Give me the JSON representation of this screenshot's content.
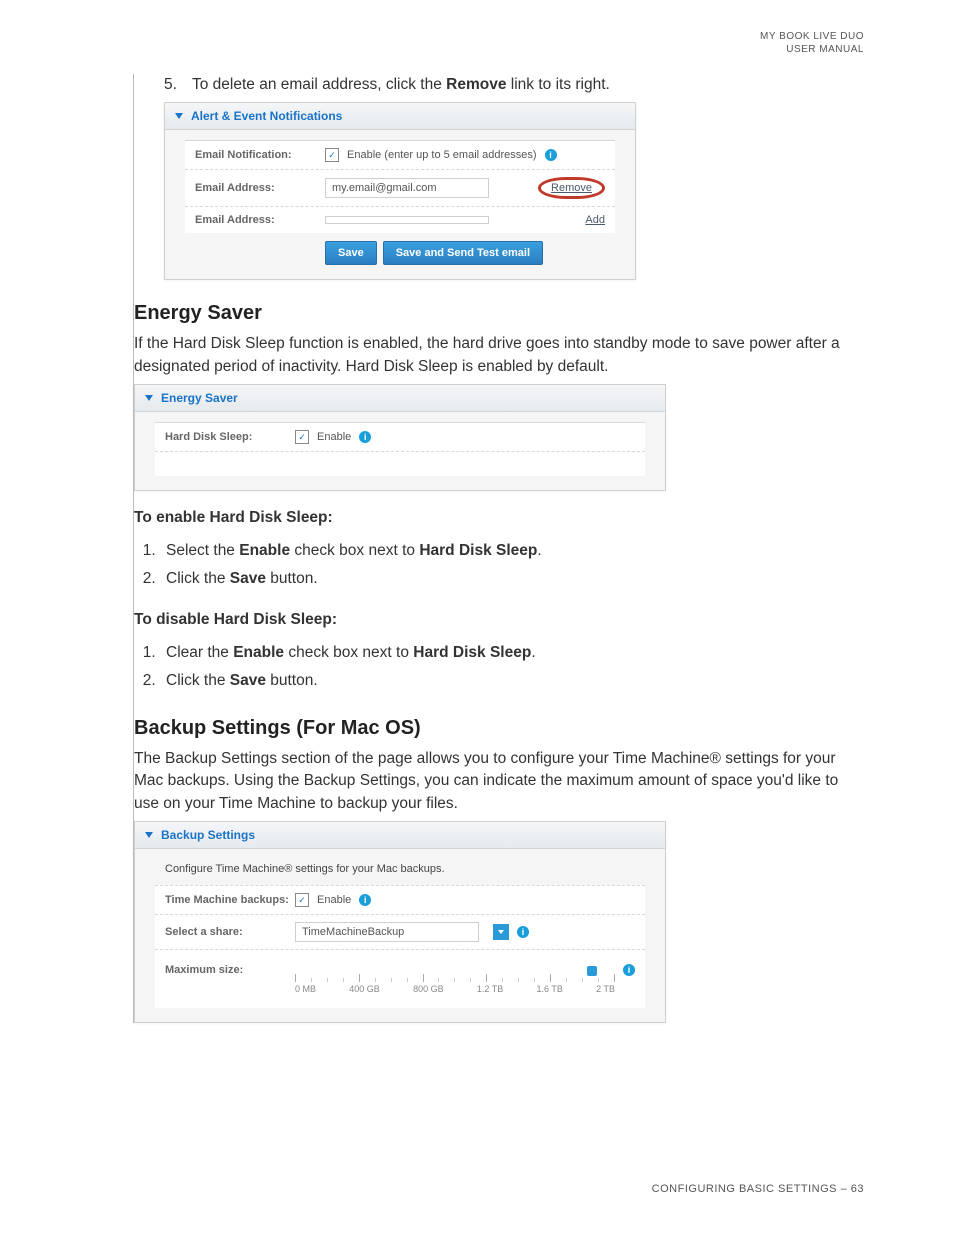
{
  "header": {
    "line1": "MY BOOK LIVE DUO",
    "line2": "USER MANUAL"
  },
  "step5": {
    "num": "5.",
    "pre": "To delete an email address, click the ",
    "bold": "Remove",
    "post": " link to its right."
  },
  "alertPanel": {
    "title": "Alert & Event Notifications",
    "rows": {
      "notifLabel": "Email Notification:",
      "notifEnable": "Enable (enter up to 5 email addresses)",
      "addrLabel": "Email Address:",
      "addrValue": "my.email@gmail.com",
      "removeLink": "Remove",
      "addLink": "Add"
    },
    "saveBtn": "Save",
    "saveTestBtn": "Save and Send Test email"
  },
  "energy": {
    "heading": "Energy Saver",
    "para": "If the Hard Disk Sleep function is enabled, the hard drive goes into standby mode to save power after a designated period of inactivity. Hard Disk Sleep is enabled by default.",
    "panelTitle": "Energy Saver",
    "hdsLabel": "Hard Disk Sleep:",
    "enableText": "Enable",
    "enableHead": "To enable Hard Disk Sleep:",
    "enable1_a": "Select the ",
    "enable1_b": "Enable",
    "enable1_c": " check box next to ",
    "enable1_d": "Hard Disk Sleep",
    "enable1_e": ".",
    "enable2_a": "Click the ",
    "enable2_b": "Save",
    "enable2_c": " button.",
    "disableHead": "To disable Hard Disk Sleep:",
    "disable1_a": "Clear the ",
    "disable1_b": "Enable",
    "disable1_c": " check box next to ",
    "disable1_d": "Hard Disk Sleep",
    "disable1_e": ".",
    "disable2_a": "Click the ",
    "disable2_b": "Save",
    "disable2_c": " button."
  },
  "backup": {
    "heading": "Backup Settings (For Mac OS)",
    "para": "The Backup Settings section of the page allows you to configure your Time Machine® settings for your Mac backups. Using the Backup Settings, you can indicate the maximum amount of space you'd like to use on your Time Machine to backup your files.",
    "panelTitle": "Backup Settings",
    "desc": "Configure Time Machine® settings for your Mac backups.",
    "tmLabel": "Time Machine backups:",
    "enableText": "Enable",
    "shareLabel": "Select a share:",
    "shareValue": "TimeMachineBackup",
    "maxLabel": "Maximum size:",
    "ticks": [
      "0 MB",
      "400 GB",
      "800 GB",
      "1.2 TB",
      "1.6 TB",
      "2 TB"
    ]
  },
  "footer": "CONFIGURING BASIC SETTINGS – 63"
}
